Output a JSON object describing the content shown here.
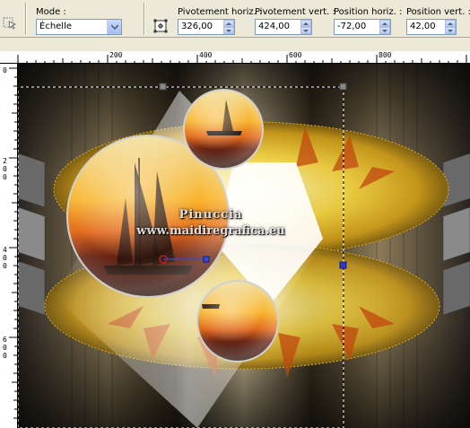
{
  "toolbar": {
    "mode_label": "Mode :",
    "mode_value": "Échelle",
    "pivot_h_label": "Pivotement horiz. :",
    "pivot_h_value": "326,00",
    "pivot_v_label": "Pivotement vert. :",
    "pivot_v_value": "424,00",
    "pos_h_label": "Position horiz. :",
    "pos_h_value": "-72,00",
    "pos_v_label": "Position vert. :",
    "pos_v_value": "42,00"
  },
  "ruler": {
    "top_labels": [
      "200",
      "400",
      "600",
      "800"
    ],
    "left_labels": [
      "0",
      "200",
      "400",
      "600"
    ]
  },
  "watermark": {
    "line1": "Pinuccia",
    "line2": "www.maidiregrafica.eu"
  },
  "colors": {
    "toolbar_bg": "#ece9d8",
    "accent_blue": "#3a4ccf",
    "gold": "#e8c020"
  }
}
